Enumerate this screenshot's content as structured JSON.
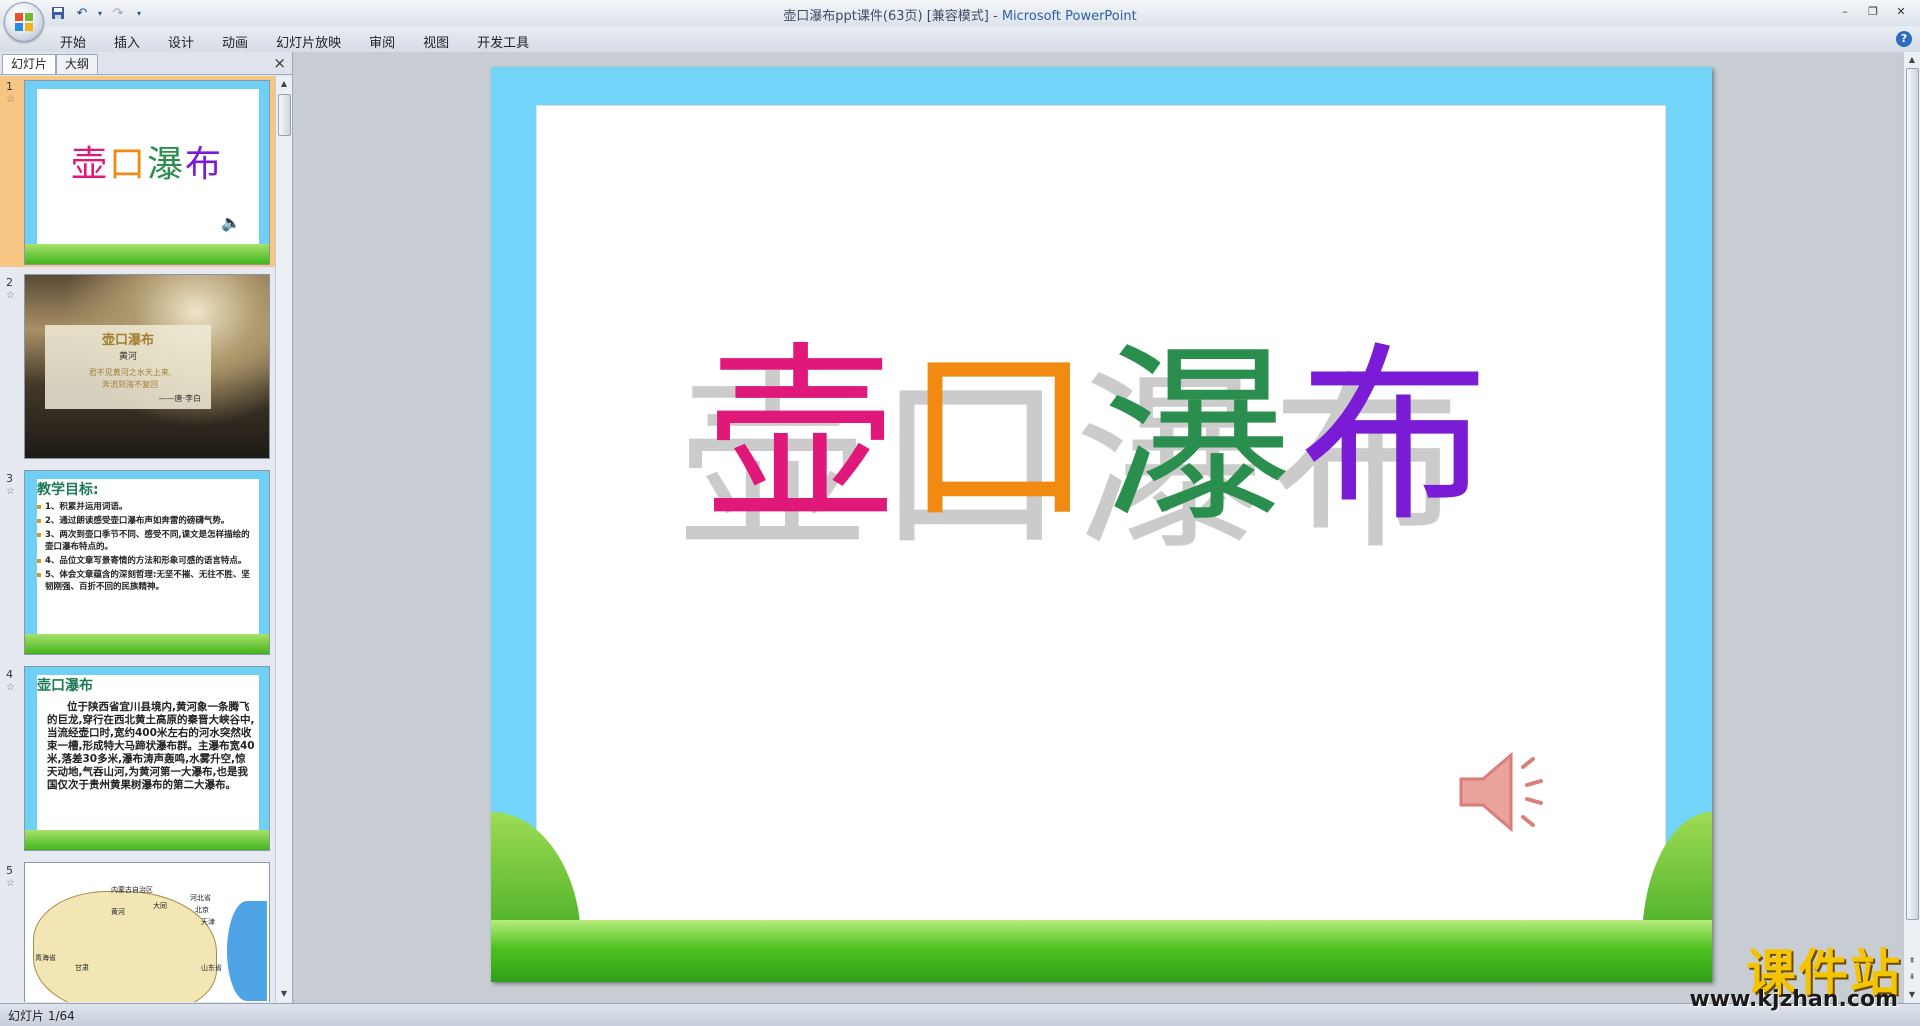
{
  "window": {
    "title_doc": "壶口瀑布ppt课件(63页) [兼容模式] - ",
    "title_app": "Microsoft PowerPoint"
  },
  "qat": {
    "save_icon": "save-icon",
    "undo_icon": "undo-icon",
    "redo_icon": "redo-icon",
    "customize_icon": "qat-dropdown-icon"
  },
  "ribbon": {
    "tabs": [
      "开始",
      "插入",
      "设计",
      "动画",
      "幻灯片放映",
      "审阅",
      "视图",
      "开发工具"
    ]
  },
  "pane": {
    "tab_slides": "幻灯片",
    "tab_outline": "大纲",
    "close": "×"
  },
  "thumbnails": [
    {
      "num": "1",
      "title": "壶口瀑布"
    },
    {
      "num": "2",
      "title": "壶口瀑布",
      "author": "黄河",
      "poem1": "君不见黄河之水天上来,",
      "poem2": "奔流到海不复回",
      "sign": "——唐·李白"
    },
    {
      "num": "3",
      "heading": "教学目标:",
      "items": [
        "1、积累并运用词语。",
        "2、通过朗读感受壶口瀑布声如奔雷的磅礴气势。",
        "3、两次到壶口季节不同、感受不同,课文是怎样描绘的壶口瀑布特点的。",
        "4、品位文章写景寄情的方法和形象可感的语言特点。",
        "5、体会文章蕴含的深刻哲理:无坚不摧、无往不胜、坚韧刚强、百折不回的民族精神。"
      ]
    },
    {
      "num": "4",
      "heading": "壶口瀑布",
      "text": "位于陕西省宜川县境内,黄河象一条腾飞的巨龙,穿行在西北黄土高原的秦晋大峡谷中,当流经壶口时,宽约400米左右的河水突然收束一槽,形成特大马蹄状瀑布群。主瀑布宽40米,落差30多米,瀑布涛声轰鸣,水雾升空,惊天动地,气吞山河,为黄河第一大瀑布,也是我国仅次于贵州黄果树瀑布的第二大瀑布。"
    },
    {
      "num": "5",
      "labels": [
        "内蒙古自治区",
        "黄河",
        "大同",
        "河北省",
        "北京",
        "天津",
        "青海省",
        "山东省",
        "甘肃"
      ]
    }
  ],
  "slide": {
    "title_chars": [
      "壶",
      "口",
      "瀑",
      "布"
    ],
    "title_colors": [
      "#e0187a",
      "#f08a10",
      "#2a8f4e",
      "#7a1bd6"
    ],
    "speaker_icon": "speaker-icon"
  },
  "status": {
    "text": "幻灯片 1/64"
  },
  "watermark": {
    "main": "课件站",
    "url": "www.kjzhan.com"
  }
}
